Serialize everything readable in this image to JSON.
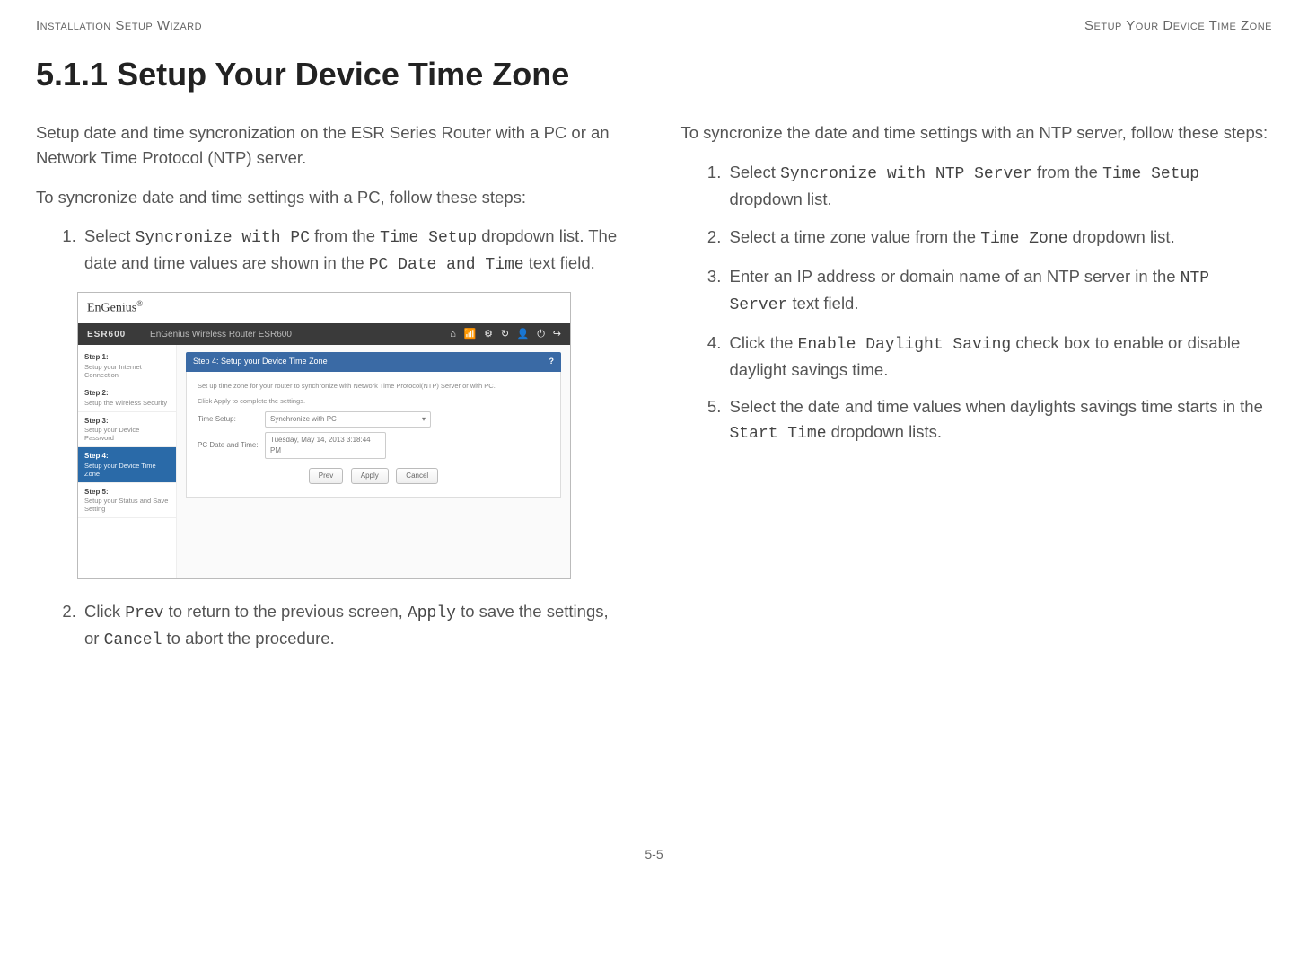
{
  "header": {
    "left": "Installation Setup Wizard",
    "right": "Setup Your Device Time Zone"
  },
  "title": "5.1.1 Setup Your Device Time Zone",
  "left": {
    "p1": "Setup date and time syncronization on the ESR Series Router with a PC or an Network Time Protocol (NTP) server.",
    "p2": "To syncronize date and time settings with a PC, follow these steps:",
    "li1_a": "Select ",
    "li1_code1": "Syncronize with PC",
    "li1_b": " from the ",
    "li1_code2": "Time Setup",
    "li1_c": " dropdown list. The date and time values are shown in the ",
    "li1_code3": "PC Date and Time",
    "li1_d": " text field.",
    "li2_a": "Click ",
    "li2_code1": "Prev",
    "li2_b": " to return to the previous screen, ",
    "li2_code2": "Apply",
    "li2_c": " to save the settings, or ",
    "li2_code3": "Cancel",
    "li2_d": " to abort the procedure."
  },
  "right": {
    "p1": "To syncronize the date and time settings with an NTP server, follow these steps:",
    "li1_a": "Select ",
    "li1_code1": "Syncronize with NTP Server",
    "li1_b": " from the ",
    "li1_code2": "Time Setup",
    "li1_c": " dropdown list.",
    "li2_a": "Select a time zone value from the ",
    "li2_code1": "Time Zone",
    "li2_b": " dropdown list.",
    "li3_a": "Enter an IP address or domain name of an NTP server in the ",
    "li3_code1": "NTP Server",
    "li3_b": " text field.",
    "li4_a": "Click the ",
    "li4_code1": "Enable Daylight Saving",
    "li4_b": " check box to enable or disable daylight savings time.",
    "li5_a": "Select the date and time values when daylights savings time starts in the ",
    "li5_code1": "Start Time",
    "li5_b": " dropdown lists."
  },
  "screenshot": {
    "brand": "EnGenius",
    "brand_sup": "®",
    "model": "ESR600",
    "subtitle": "EnGenius Wireless Router ESR600",
    "sidebar": {
      "s1_t": "Step 1:",
      "s1_d": "Setup your Internet Connection",
      "s2_t": "Step 2:",
      "s2_d": "Setup the Wireless Security",
      "s3_t": "Step 3:",
      "s3_d": "Setup your Device Password",
      "s4_t": "Step 4:",
      "s4_d": "Setup your Device Time Zone",
      "s5_t": "Step 5:",
      "s5_d": "Setup your Status and Save Setting"
    },
    "panel": {
      "head": "Step 4: Setup your Device Time Zone",
      "help_icon": "?",
      "desc1": "Set up time zone for your router to synchronize with Network Time Protocol(NTP) Server or with PC.",
      "desc2": "Click Apply to complete the settings.",
      "lbl_timesetup": "Time Setup:",
      "val_timesetup": "Synchronize with PC",
      "lbl_pcdate": "PC Date and Time:",
      "val_pcdate": "Tuesday, May 14, 2013 3:18:44 PM",
      "btn_prev": "Prev",
      "btn_apply": "Apply",
      "btn_cancel": "Cancel"
    }
  },
  "footer": "5-5"
}
